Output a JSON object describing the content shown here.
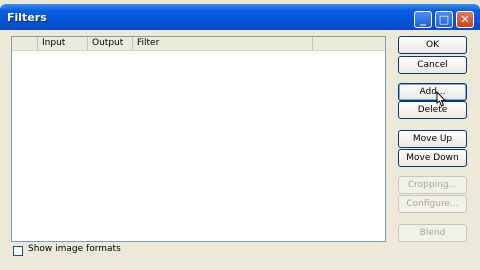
{
  "window": {
    "title": "Filters"
  },
  "list": {
    "columns": [
      "",
      "Input",
      "Output",
      "Filter"
    ]
  },
  "buttons": {
    "ok": "OK",
    "cancel": "Cancel",
    "add": "Add...",
    "delete": "Delete",
    "move_up": "Move Up",
    "move_down": "Move Down",
    "cropping": "Cropping...",
    "configure": "Configure...",
    "blend": "Blend"
  },
  "options": {
    "show_image_formats_label": "Show image formats",
    "show_image_formats_checked": false
  },
  "titlebar_buttons": {
    "minimize": "_",
    "maximize": "□",
    "close": "✕"
  }
}
